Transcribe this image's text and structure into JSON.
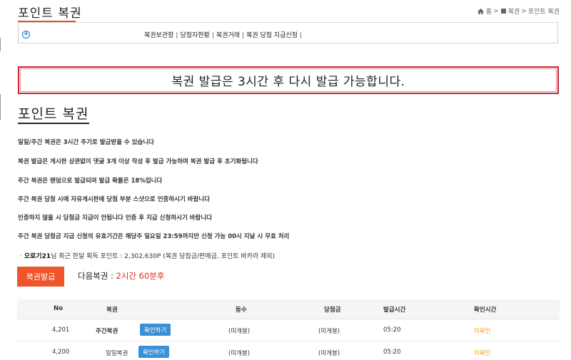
{
  "header": {
    "title": "포인트 복권",
    "breadcrumb": {
      "home": "홈",
      "section": "복권",
      "current": "포인트 복권",
      "sep": ">"
    }
  },
  "nav": {
    "links": [
      "복권보관함",
      "당첨자현황",
      "복권거래",
      "복권 당첨 지급신청"
    ],
    "sep": "|"
  },
  "alert": {
    "message": "복권 발급은 3시간 후 다시 발급 가능합니다."
  },
  "section": {
    "title": "포인트 복권"
  },
  "info_lines": [
    "일일/주간 복권은 3시간 주기로 발급받을 수 있습니다",
    "복권 발급은 게시판 상관없이 댓글 3개 이상 작성 후 발급 가능하며 복권 발급 후 초기화됩니다",
    "주간 복권은 랜덤으로 발급되며 발급 확률은 18%입니다",
    "주간 복권 당첨 시에 자유게시판에 당첨 부분 스샷으로 인증하시기 바랍니다",
    "인증하지 않을 시 당첨금 지급이 안됩니다 인증 후 지급 신청하시기 바랍니다",
    "주간 복권 당첨금 지급 신청의 유효기간은 해당주 일요일 23:59까지만 신청 가능 00시 지날 시 무효 처리"
  ],
  "points": {
    "bullet": "·",
    "user": "오로기21",
    "text": "님 최근 한달 획득 포인트 : 2,302,630P (복권 당첨금/판매금, 포인트 바카라 제외)"
  },
  "issue_button": {
    "label": "복권발급"
  },
  "next": {
    "label": "다음복권 :",
    "time": "2시간 60분후"
  },
  "table": {
    "columns": [
      "No",
      "복권",
      "등수",
      "당첨금",
      "발급시간",
      "확인시간"
    ],
    "rows": [
      {
        "no": "4,201",
        "type": "주간복권",
        "action": "확인하기",
        "rank": "(미개봉)",
        "prize": "(미개봉)",
        "issued": "05:20",
        "checked": "미확인"
      },
      {
        "no": "4,200",
        "type": "일일복권",
        "action": "확인하기",
        "rank": "(미개봉)",
        "prize": "(미개봉)",
        "issued": "05:20",
        "checked": "미확인"
      }
    ]
  },
  "icons": {
    "home": "home-icon",
    "square": "square-icon",
    "plus": "plus-circle-icon"
  },
  "colors": {
    "accent": "#f0542a",
    "alert_border": "#c8283a",
    "button_blue": "#3b8fd6",
    "unconfirmed": "#f0a020",
    "countdown": "#d93025"
  }
}
